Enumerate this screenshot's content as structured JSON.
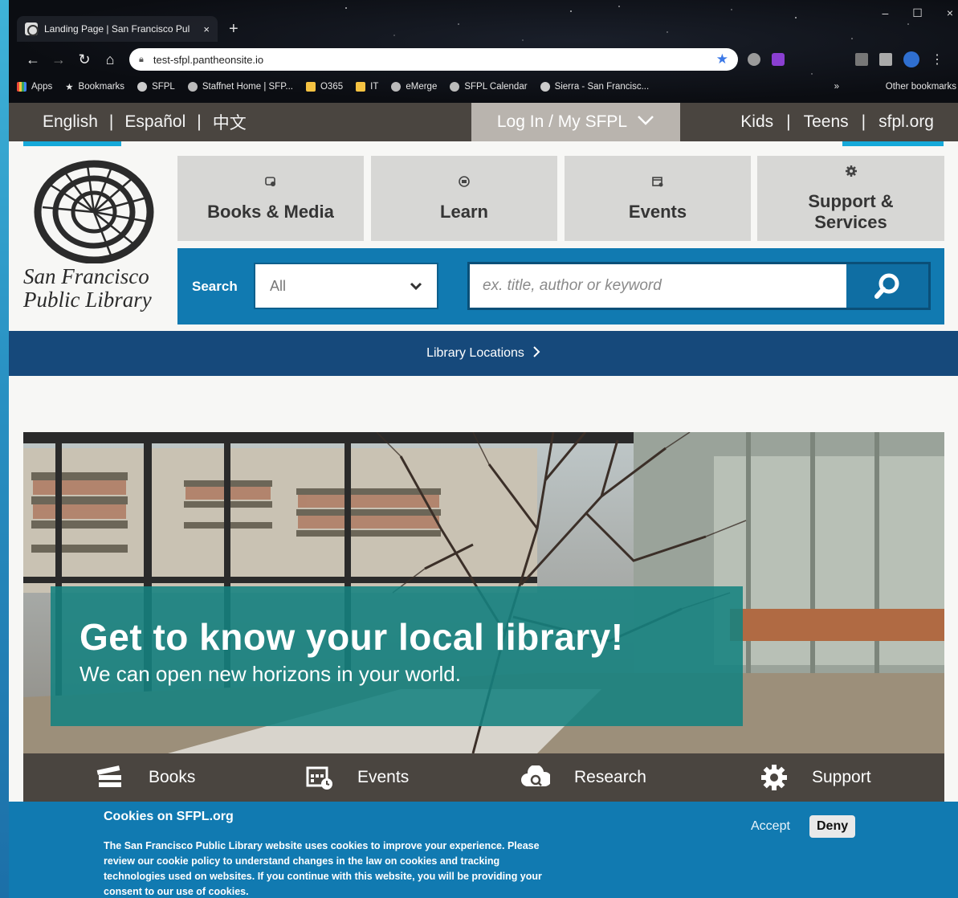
{
  "browser": {
    "tab_title": "Landing Page | San Francisco Pul",
    "tab_close": "×",
    "new_tab": "+",
    "url": "test-sfpl.pantheonsite.io",
    "window_controls": [
      "–",
      "☐",
      "×"
    ],
    "bookmarks": [
      {
        "label": "Apps",
        "icon": "apps-grid-icon",
        "color": "#f5c242"
      },
      {
        "label": "Bookmarks",
        "icon": "star-icon",
        "color": "#ffffff"
      },
      {
        "label": "SFPL",
        "icon": "sfpl-icon",
        "color": "#cccccc"
      },
      {
        "label": "Staffnet Home | SFP...",
        "icon": "globe-icon",
        "color": "#bbbbbb"
      },
      {
        "label": "O365",
        "icon": "folder-icon",
        "color": "#f5c242"
      },
      {
        "label": "IT",
        "icon": "folder-icon",
        "color": "#f5c242"
      },
      {
        "label": "eMerge",
        "icon": "globe-icon",
        "color": "#bbbbbb"
      },
      {
        "label": "SFPL Calendar",
        "icon": "globe-icon",
        "color": "#bbbbbb"
      },
      {
        "label": "Sierra - San Francisc...",
        "icon": "sfpl-icon",
        "color": "#cccccc"
      }
    ],
    "bookmarks_more": "»",
    "other_bookmarks": "Other bookmarks"
  },
  "topbar": {
    "languages": [
      "English",
      "Español",
      "中文"
    ],
    "login_label": "Log In / My SFPL",
    "right_links": [
      "Kids",
      "Teens",
      "sfpl.org"
    ]
  },
  "logo": {
    "line1": "San Francisco",
    "line2": "Public Library"
  },
  "mega_menu": [
    {
      "label": "Books & Media",
      "icon": "books-media-icon"
    },
    {
      "label": "Learn",
      "icon": "learn-icon"
    },
    {
      "label": "Events",
      "icon": "events-calendar-icon"
    },
    {
      "label": "Support & Services",
      "icon": "gear-icon"
    }
  ],
  "search": {
    "label": "Search",
    "scope_value": "All",
    "placeholder": "ex. title, author or keyword"
  },
  "locations": {
    "label": "Library Locations"
  },
  "hero": {
    "title": "Get to know your local library!",
    "subtitle": "We can open new horizons in your world."
  },
  "quick_links": [
    {
      "label": "Books",
      "icon": "books-icon"
    },
    {
      "label": "Events",
      "icon": "calendar-clock-icon"
    },
    {
      "label": "Research",
      "icon": "research-cloud-icon"
    },
    {
      "label": "Support",
      "icon": "support-gear-icon"
    }
  ],
  "cookie": {
    "title": "Cookies on SFPL.org",
    "body": "The San Francisco Public Library website uses cookies to improve your experience. Please review our cookie policy to understand changes in the law on cookies and tracking technologies used on websites. If you continue with this website, you will be providing your consent to our use of cookies.",
    "accept": "Accept",
    "deny": "Deny"
  },
  "colors": {
    "topbar": "#4a4540",
    "login_bg": "#b9b4ae",
    "accent_teal": "#16a9d9",
    "search_blue": "#117ab1",
    "locations_navy": "#16497b",
    "hero_card": "#148280"
  }
}
